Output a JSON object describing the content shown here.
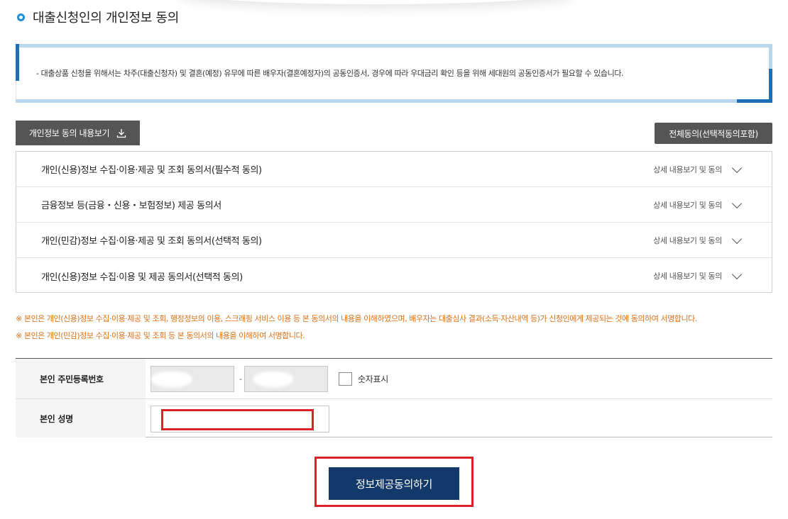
{
  "section": {
    "title": "대출신청인의 개인정보 동의"
  },
  "notice": {
    "text": "- 대출상품 신청을 위해서는 차주(대출신청자) 및 결혼(예정) 유무에 따른 배우자(결혼예정자)의 공동인증서, 경우에 따라 우대금리 확인 등을 위해 세대원의 공동인증서가 필요할 수 있습니다."
  },
  "buttons": {
    "view_label": "개인정보 동의 내용보기",
    "agree_all_label": "전체동의(선택적동의포함)",
    "submit_label": "정보제공동의하기"
  },
  "consents": [
    {
      "label": "개인(신용)정보 수집·이용·제공 및 조회 동의서(필수적 동의)",
      "more": "상세 내용보기 및 동의"
    },
    {
      "label": "금융정보 등(금융・신용・보험정보) 제공 동의서",
      "more": "상세 내용보기 및 동의"
    },
    {
      "label": "개인(민감)정보 수집·이용·제공 및 조회 동의서(선택적 동의)",
      "more": "상세 내용보기 및 동의"
    },
    {
      "label": "개인(신용)정보 수집·이용 및 제공 동의서(선택적 동의)",
      "more": "상세 내용보기 및 동의"
    }
  ],
  "warnings": [
    "※ 본인은 개인(신용)정보 수집·이용·제공 및 조회, 행정정보의 이용, 스크래핑 서비스 이용 등 본 동의서의 내용을 이해하였으며, 배우자는 대출심사 결과(소득·자산내역 등)가 신청인에게 제공되는 것에 동의하여 서명합니다.",
    "※ 본인은 개인(민감)정보 수집·이용·제공 및 조회 등 본 동의서의 내용을 이해하여 서명합니다."
  ],
  "form": {
    "ssn_label": "본인 주민등록번호",
    "ssn_separator": "-",
    "show_digits_label": "숫자표시",
    "name_label": "본인 성명"
  },
  "colors": {
    "accent": "#1f8fd8",
    "dark_button": "#555555",
    "submit_button": "#13396a",
    "warning_text": "#d9721a",
    "highlight": "#dc2127"
  }
}
